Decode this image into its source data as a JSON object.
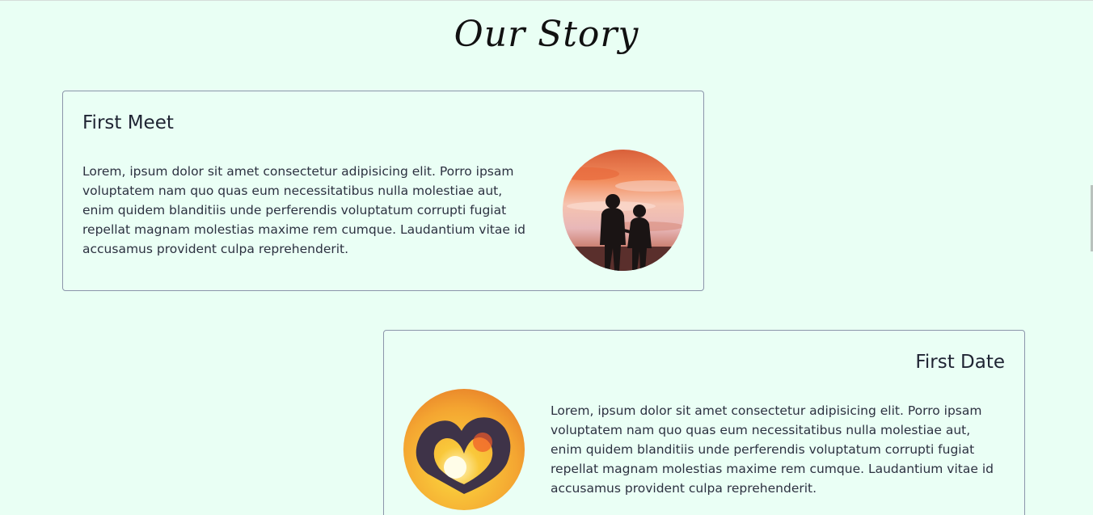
{
  "page": {
    "title": "Our Story"
  },
  "stories": [
    {
      "title": "First Meet",
      "text": "Lorem, ipsum dolor sit amet consectetur adipisicing elit. Porro ipsam voluptatem nam quo quas eum necessitatibus nulla molestiae aut, enim quidem blanditiis unde perferendis voluptatum corrupti fugiat repellat magnam molestias maxime rem cumque. Laudantium vitae id accusamus provident culpa reprehenderit.",
      "image": "couple-silhouette-sunset-photo"
    },
    {
      "title": "First Date",
      "text": "Lorem, ipsum dolor sit amet consectetur adipisicing elit. Porro ipsam voluptatem nam quo quas eum necessitatibus nulla molestiae aut, enim quidem blanditiis unde perferendis voluptatum corrupti fugiat repellat magnam molestias maxime rem cumque. Laudantium vitae id accusamus provident culpa reprehenderit.",
      "image": "heart-hands-sun-photo"
    }
  ],
  "colors": {
    "background": "#e9fff4",
    "card_border": "#8b95aa",
    "text": "#2c3140"
  }
}
